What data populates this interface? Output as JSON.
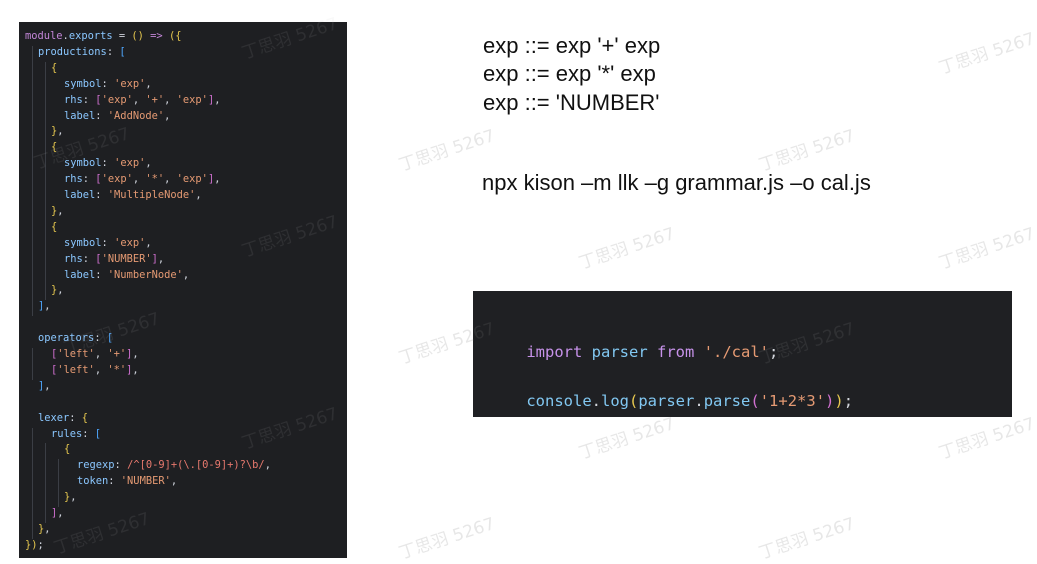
{
  "editor": {
    "lines": [
      [
        "module",
        ".",
        "exports",
        " = ",
        "()",
        " => ",
        "(",
        "{"
      ],
      [
        "productions",
        ": ",
        "["
      ],
      [
        "{"
      ],
      [
        "symbol",
        ": ",
        "'exp'",
        ","
      ],
      [
        "rhs",
        ": ",
        "[",
        "'exp'",
        ", ",
        "'+'",
        ", ",
        "'exp'",
        "]",
        ","
      ],
      [
        "label",
        ": ",
        "'AddNode'",
        ","
      ],
      [
        "}",
        ","
      ],
      [
        "{"
      ],
      [
        "symbol",
        ": ",
        "'exp'",
        ","
      ],
      [
        "rhs",
        ": ",
        "[",
        "'exp'",
        ", ",
        "'*'",
        ", ",
        "'exp'",
        "]",
        ","
      ],
      [
        "label",
        ": ",
        "'MultipleNode'",
        ","
      ],
      [
        "}",
        ","
      ],
      [
        "{"
      ],
      [
        "symbol",
        ": ",
        "'exp'",
        ","
      ],
      [
        "rhs",
        ": ",
        "[",
        "'NUMBER'",
        "]",
        ","
      ],
      [
        "label",
        ": ",
        "'NumberNode'",
        ","
      ],
      [
        "}",
        ","
      ],
      [
        "]",
        ","
      ],
      [
        ""
      ],
      [
        "operators",
        ": ",
        "["
      ],
      [
        "[",
        "'left'",
        ", ",
        "'+'",
        "]",
        ","
      ],
      [
        "[",
        "'left'",
        ", ",
        "'*'",
        "]",
        ","
      ],
      [
        "]",
        ","
      ],
      [
        ""
      ],
      [
        "lexer",
        ": ",
        "{"
      ],
      [
        "rules",
        ": ",
        "["
      ],
      [
        "{"
      ],
      [
        "regexp",
        ": ",
        "/^[0-9]+(\\.[0-9]+)?\\b/",
        ","
      ],
      [
        "token",
        ": ",
        "'NUMBER'",
        ","
      ],
      [
        "}",
        ","
      ],
      [
        "]",
        ","
      ],
      [
        "}",
        ","
      ],
      [
        "}",
        ")",
        ";"
      ]
    ]
  },
  "grammar": {
    "rules": [
      "exp ::= exp '+' exp",
      "exp ::= exp '*' exp",
      "exp ::= 'NUMBER'"
    ]
  },
  "command": "npx kison –m llk –g grammar.js –o cal.js",
  "usage": {
    "line1": [
      "import",
      " ",
      "parser",
      " ",
      "from",
      " ",
      "'./cal'",
      ";"
    ],
    "line2": [
      "console",
      ".",
      "log",
      "(",
      "parser",
      ".",
      "parse",
      "(",
      "'1+2*3'",
      ")",
      ")",
      ";"
    ]
  },
  "watermark": "丁思羽 5267",
  "colors": {
    "editor_bg": "#1e1f22",
    "keyword": "#c386d8",
    "string": "#e59a73",
    "property": "#8bc7ff",
    "bracket": "#e6c84f"
  }
}
